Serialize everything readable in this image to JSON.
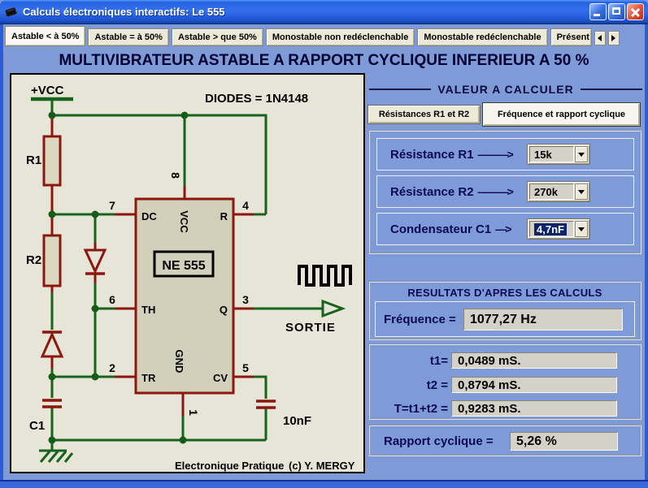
{
  "window": {
    "title": "Calculs électroniques interactifs: Le 555"
  },
  "tabs": [
    {
      "label": "Astable < à 50%"
    },
    {
      "label": "Astable = à 50%"
    },
    {
      "label": "Astable > que 50%"
    },
    {
      "label": "Monostable non redéclenchable"
    },
    {
      "label": "Monostable redéclenchable"
    },
    {
      "label": "Présent"
    }
  ],
  "banner": {
    "title": "MULTIVIBRATEUR ASTABLE A RAPPORT CYCLIQUE INFERIEUR A 50 %"
  },
  "schematic": {
    "vcc": "+VCC",
    "diodes_note": "DIODES = 1N4148",
    "r1": "R1",
    "r2": "R2",
    "c1": "C1",
    "c2": "10nF",
    "chip": "NE 555",
    "output": "SORTIE",
    "credit_publisher": "Electronique Pratique",
    "credit_author": "(c) Y. MERGY",
    "pins": {
      "p1": "1",
      "p2": "2",
      "p3": "3",
      "p4": "4",
      "p5": "5",
      "p6": "6",
      "p7": "7",
      "p8": "8",
      "dc": "DC",
      "vcc": "VCC",
      "r": "R",
      "th": "TH",
      "q": "Q",
      "gnd": "GND",
      "tr": "TR",
      "cv": "CV"
    }
  },
  "calculator": {
    "header": "VALEUR A CALCULER",
    "modes": [
      {
        "label": "Résistances R1 et R2"
      },
      {
        "label": "Fréquence et rapport cyclique"
      }
    ],
    "inputs": [
      {
        "label": "Résistance R1",
        "arrow": "———>",
        "value": "15k"
      },
      {
        "label": "Résistance R2",
        "arrow": "———>",
        "value": "270k"
      },
      {
        "label": "Condensateur C1",
        "arrow": "—>",
        "value": "4,7nF"
      }
    ],
    "results": {
      "header": "RESULTATS D'APRES LES CALCULS",
      "frequency_label": "Fréquence =",
      "frequency_value": "1077,27 Hz",
      "t1_label": "t1=",
      "t1_value": "0,0489 mS.",
      "t2_label": "t2 =",
      "t2_value": "0,8794 mS.",
      "t_total_label": "T=t1+t2 =",
      "t_total_value": "0,9283 mS.",
      "duty_label": "Rapport cyclique =",
      "duty_value": "5,26 %"
    }
  },
  "colors": {
    "selection_bg": "#0A246A",
    "wire_green": "#17631A",
    "component_red": "#8B170E",
    "panel_blue": "#7E9BD8",
    "schematic_bg": "#E7E5D8"
  }
}
